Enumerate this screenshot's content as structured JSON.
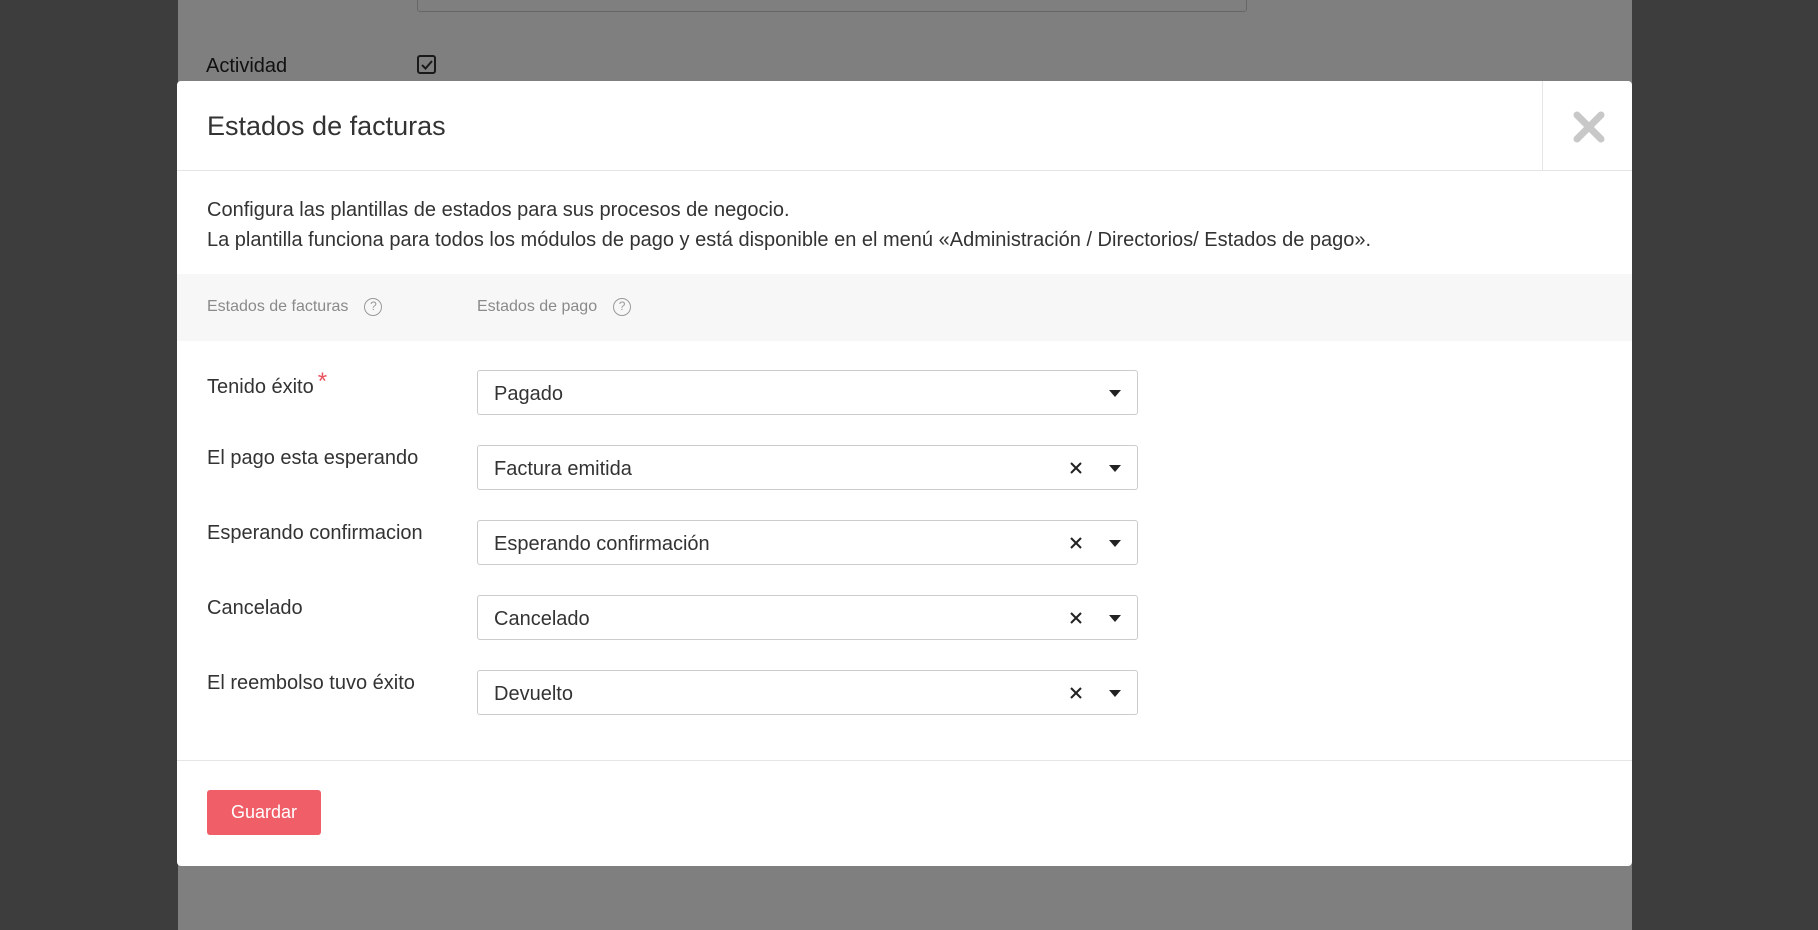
{
  "background": {
    "activity_label": "Actividad",
    "activity_checked": true
  },
  "modal": {
    "title": "Estados de facturas",
    "intro_line1": "Configura las plantillas de estados para sus procesos de negocio.",
    "intro_line2": "La plantilla funciona para todos los módulos de pago y está disponible en el menú «Administración / Directorios/ Estados de pago».",
    "col_invoice_states": "Estados de facturas",
    "col_payment_states": "Estados de pago",
    "help_glyph": "?",
    "rows": [
      {
        "label": "Tenido éxito",
        "required": true,
        "value": "Pagado",
        "clearable": false
      },
      {
        "label": "El pago esta esperando",
        "required": false,
        "value": "Factura emitida",
        "clearable": true
      },
      {
        "label": "Esperando confirmacion",
        "required": false,
        "value": "Esperando confirmación",
        "clearable": true
      },
      {
        "label": "Cancelado",
        "required": false,
        "value": "Cancelado",
        "clearable": true
      },
      {
        "label": "El reembolso tuvo éxito",
        "required": false,
        "value": "Devuelto",
        "clearable": true
      }
    ],
    "required_mark": "*",
    "save_label": "Guardar"
  },
  "colors": {
    "accent": "#f05f68",
    "required": "#e9545f",
    "overlay": "rgba(0,0,0,0.5)"
  },
  "icons": {
    "close": "close-icon",
    "help": "help-icon",
    "clear": "clear-icon",
    "caret": "chevron-down-icon",
    "checkbox": "checkbox-checked-icon"
  }
}
